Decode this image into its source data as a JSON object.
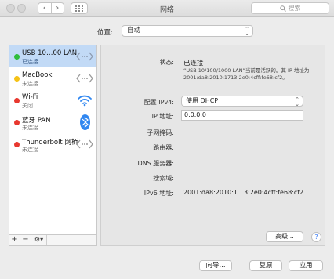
{
  "window": {
    "title": "网络",
    "search_placeholder": "搜索"
  },
  "location": {
    "label": "位置:",
    "value": "自动"
  },
  "services": [
    {
      "name": "USB 10…00 LAN",
      "status": "已连接",
      "status_color": "#2ebd3c",
      "icon": "ethernet-icon",
      "selected": true
    },
    {
      "name": "MacBook",
      "status": "未连接",
      "status_color": "#f5c216",
      "icon": "ethernet-icon",
      "selected": false
    },
    {
      "name": "Wi-Fi",
      "status": "关闭",
      "status_color": "#e8382f",
      "icon": "wifi-icon",
      "selected": false
    },
    {
      "name": "蓝牙 PAN",
      "status": "未连接",
      "status_color": "#e8382f",
      "icon": "bluetooth-icon",
      "selected": false
    },
    {
      "name": "Thunderbolt 网桥",
      "status": "未连接",
      "status_color": "#e8382f",
      "icon": "ethernet-icon",
      "selected": false
    }
  ],
  "sidebar_buttons": {
    "add": "+",
    "remove": "−",
    "gear": "⚙▾"
  },
  "detail": {
    "status_label": "状态:",
    "status_value": "已连接",
    "status_desc": "“USB 10/100/1000 LAN”当前是活跃的。其 IP 地址为 2001:da8:2010:1713:2e0:4cff:fe68:cf2。",
    "configure_ipv4_label": "配置 IPv4:",
    "configure_ipv4_value": "使用 DHCP",
    "ip_label": "IP 地址:",
    "ip_value": "0.0.0.0",
    "subnet_label": "子网掩码:",
    "router_label": "路由器:",
    "dns_label": "DNS 服务器:",
    "search_domains_label": "搜索域:",
    "ipv6_label": "IPv6 地址:",
    "ipv6_value": "2001:da8:2010:1…3:2e0:4cff:fe68:cf2",
    "advanced_button": "高级...",
    "help_button": "?"
  },
  "footer": {
    "assist_button": "向导...",
    "revert_button": "复原",
    "apply_button": "应用"
  },
  "colors": {
    "selection": "#c2daf6",
    "connected": "#2ebd3c",
    "bluetooth": "#2f86f0"
  }
}
